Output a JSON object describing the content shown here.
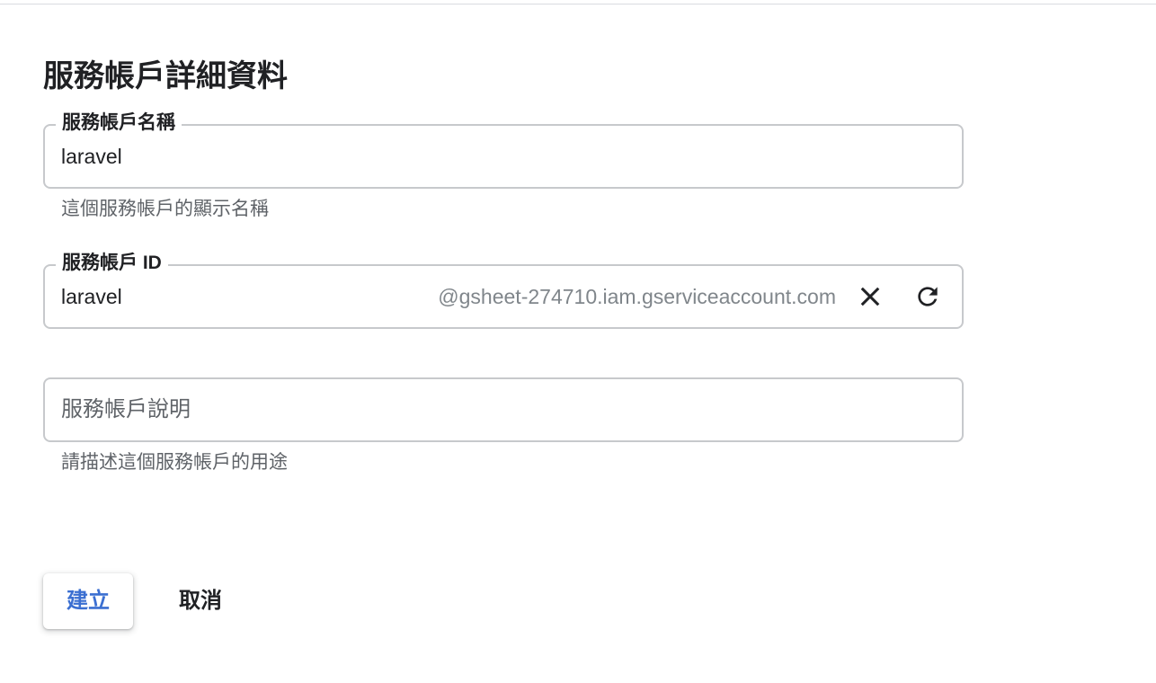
{
  "page": {
    "title": "服務帳戶詳細資料"
  },
  "fields": {
    "name": {
      "label": "服務帳戶名稱",
      "value": "laravel",
      "helper": "這個服務帳戶的顯示名稱"
    },
    "id": {
      "label": "服務帳戶 ID",
      "value": "laravel",
      "suffix": "@gsheet-274710.iam.gserviceaccount.com",
      "clear_icon": "close-icon",
      "refresh_icon": "refresh-icon"
    },
    "description": {
      "placeholder": "服務帳戶說明",
      "helper": "請描述這個服務帳戶的用途"
    }
  },
  "actions": {
    "create_label": "建立",
    "cancel_label": "取消"
  },
  "colors": {
    "primary_button_text": "#3b6fd1",
    "outline": "#c7c9cc",
    "helper_text": "#5f6368",
    "suffix_text": "#80868b"
  }
}
